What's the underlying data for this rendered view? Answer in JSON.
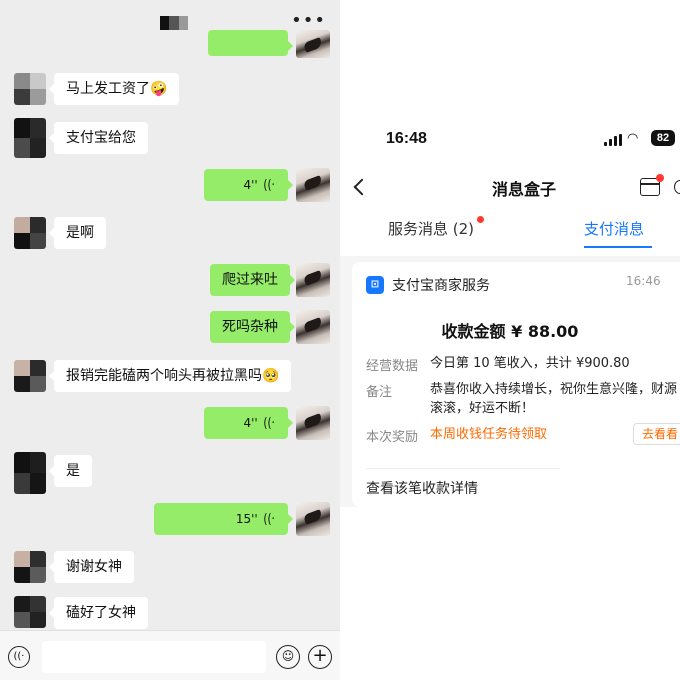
{
  "chat": {
    "more_icon": "more-dots-icon",
    "messages": [
      {
        "side": "in",
        "text": "马上发工资了🤪"
      },
      {
        "side": "in",
        "text": "支付宝给您"
      },
      {
        "side": "out",
        "type": "voice",
        "text": "4''"
      },
      {
        "side": "in",
        "text": "是啊"
      },
      {
        "side": "out",
        "text": "爬过来吐"
      },
      {
        "side": "out",
        "text": "死吗杂种"
      },
      {
        "side": "in",
        "text": "报销完能磕两个响头再被拉黑吗🥺"
      },
      {
        "side": "out",
        "type": "voice",
        "text": "4''"
      },
      {
        "side": "in",
        "text": "是"
      },
      {
        "side": "out",
        "type": "voice",
        "text": "15''"
      },
      {
        "side": "in",
        "text": "谢谢女神"
      },
      {
        "side": "in",
        "text": "磕好了女神"
      }
    ],
    "input_bar": {
      "voice_icon": "voice-input-icon",
      "emoji_icon": "emoji-icon",
      "plus_icon": "plus-icon"
    }
  },
  "alipay": {
    "status": {
      "time": "16:48",
      "battery": "82"
    },
    "nav_title": "消息盒子",
    "tabs": [
      {
        "label": "服务消息 (2)",
        "active": false,
        "has_dot": true
      },
      {
        "label": "支付消息",
        "active": true
      }
    ],
    "card": {
      "merchant": "支付宝商家服务",
      "time": "16:46",
      "amount": "收款金额 ¥ 88.00",
      "rows": [
        {
          "label": "经营数据",
          "value": "今日第 10 笔收入，共计 ¥900.80"
        },
        {
          "label": "备注",
          "value": "恭喜你收入持续增长，祝你生意兴隆，财源滚滚，好运不断！"
        },
        {
          "label": "本次奖励",
          "value": "本周收钱任务待领取"
        }
      ],
      "reward_button": "去看看",
      "detail_link": "查看该笔收款详情"
    },
    "colors": {
      "accent": "#1677ff",
      "reward": "#ff6a00",
      "badge": "#ff3b30",
      "bubble_out": "#95ec69"
    }
  }
}
